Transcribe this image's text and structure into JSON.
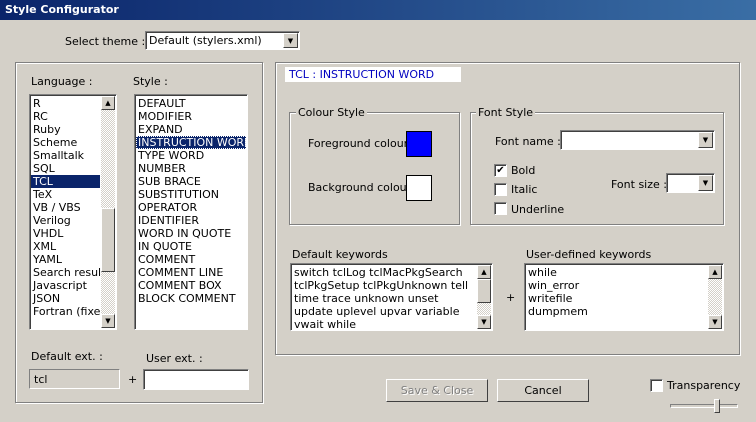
{
  "window": {
    "title": "Style Configurator"
  },
  "theme": {
    "label": "Select theme :",
    "value": "Default (stylers.xml)"
  },
  "language": {
    "label": "Language :",
    "items": [
      "R",
      "RC",
      "Ruby",
      "Scheme",
      "Smalltalk",
      "SQL",
      "TCL",
      "TeX",
      "VB / VBS",
      "Verilog",
      "VHDL",
      "XML",
      "YAML",
      "Search result",
      "Javascript",
      "JSON",
      "Fortran (fixed"
    ],
    "selected": "TCL"
  },
  "style": {
    "label": "Style :",
    "items": [
      "DEFAULT",
      "MODIFIER",
      "EXPAND",
      "INSTRUCTION WORD",
      "TYPE WORD",
      "NUMBER",
      "SUB BRACE",
      "SUBSTITUTION",
      "OPERATOR",
      "IDENTIFIER",
      "WORD IN QUOTE",
      "IN QUOTE",
      "COMMENT",
      "COMMENT LINE",
      "COMMENT BOX",
      "BLOCK COMMENT"
    ],
    "selected": "INSTRUCTION WORD"
  },
  "ext": {
    "default_label": "Default ext. :",
    "default_value": "tcl",
    "user_label": "User ext. :",
    "user_value": "",
    "plus": "+"
  },
  "header": {
    "current_style": "TCL : INSTRUCTION WORD"
  },
  "colour_style": {
    "title": "Colour Style",
    "fg_label": "Foreground colour",
    "bg_label": "Background colour",
    "fg_color": "#0000ff",
    "bg_color": "#ffffff"
  },
  "font_style": {
    "title": "Font Style",
    "name_label": "Font name :",
    "name_value": "",
    "size_label": "Font size :",
    "size_value": "",
    "bold_label": "Bold",
    "bold_checked": true,
    "italic_label": "Italic",
    "italic_checked": false,
    "underline_label": "Underline",
    "underline_checked": false
  },
  "keywords": {
    "default_label": "Default keywords",
    "default_text": "switch tclLog tclMacPkgSearch tclPkgSetup tclPkgUnknown tell time trace unknown unset update uplevel upvar variable vwait while",
    "plus": "+",
    "user_label": "User-defined keywords",
    "user_lines": [
      "while",
      "win_error",
      "writefile",
      "dumpmem"
    ]
  },
  "buttons": {
    "save_close": "Save & Close",
    "cancel": "Cancel"
  },
  "transparency": {
    "label": "Transparency",
    "checked": false,
    "level": 0.72
  },
  "icons": {
    "scroll_up": "▲",
    "scroll_down": "▼",
    "combo_arrow": "▼",
    "check": "✔"
  }
}
